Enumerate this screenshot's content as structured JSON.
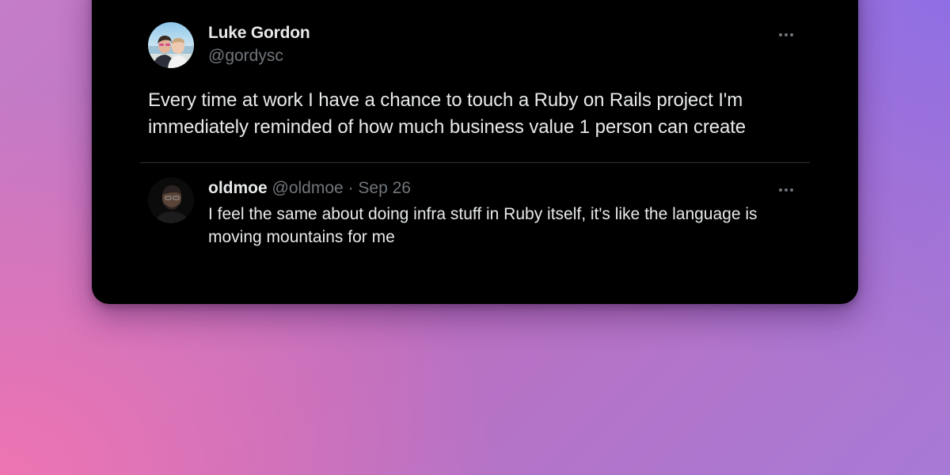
{
  "tweet": {
    "author": {
      "name": "Luke Gordon",
      "handle": "@gordysc",
      "avatar_icon": "user-avatar-photo"
    },
    "text": "Every time at work I have a chance to touch a Ruby on Rails project I'm immediately reminded of how much business value 1 person can create",
    "more_icon": "more-horizontal-icon"
  },
  "reply": {
    "author": {
      "name": "oldmoe",
      "handle": "@oldmoe",
      "avatar_icon": "user-avatar-photo"
    },
    "separator": "·",
    "date": "Sep 26",
    "text": "I feel the same about doing infra stuff in Ruby itself, it's like the language is moving mountains for me",
    "more_icon": "more-horizontal-icon"
  },
  "colors": {
    "card_background": "#000000",
    "primary_text": "#e7e9ea",
    "secondary_text": "#71767b",
    "divider": "#2f3336",
    "gradient_pink": "#ee74b2",
    "gradient_purple": "#8f6fe4"
  }
}
